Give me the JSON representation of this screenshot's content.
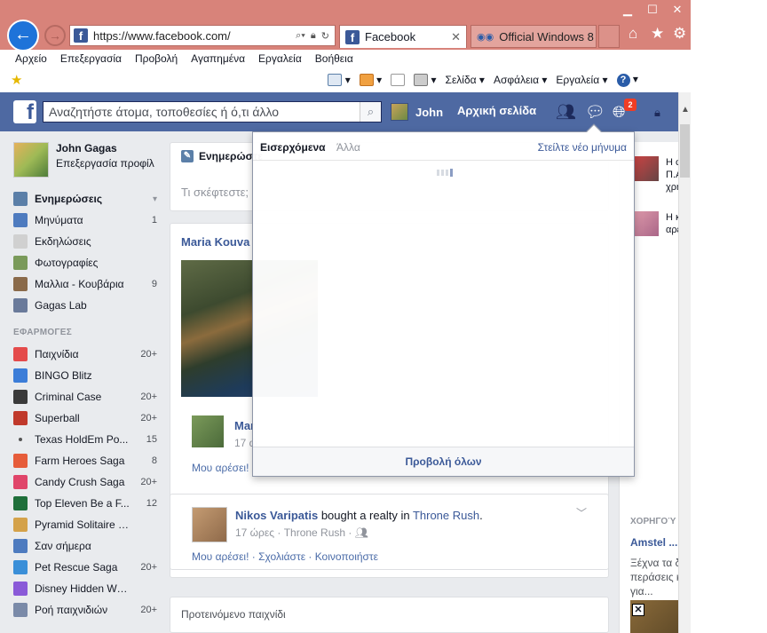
{
  "browser": {
    "url": "https://www.facebook.com/",
    "tabs": [
      {
        "label": "Facebook",
        "active": true
      },
      {
        "label": "Official Windows 8 ...",
        "active": false
      }
    ],
    "menu": [
      "Αρχείο",
      "Επεξεργασία",
      "Προβολή",
      "Αγαπημένα",
      "Εργαλεία",
      "Βοήθεια"
    ],
    "commands": [
      "Σελίδα",
      "Ασφάλεια",
      "Εργαλεία"
    ],
    "icons": {
      "back": "arrow-left-icon",
      "forward": "arrow-right-icon",
      "home": "home-icon",
      "favorites": "star-icon",
      "tools": "gear-icon"
    },
    "accent_color": "#d8837a"
  },
  "fb_header": {
    "search_placeholder": "Αναζητήστε άτομα, τοποθεσίες ή ό,τι άλλο",
    "user_name": "John",
    "home_label": "Αρχική σελίδα",
    "notification_count": "2",
    "bar_color": "#4e69a2"
  },
  "sidebar": {
    "profile_name": "John Gagas",
    "profile_edit": "Επεξεργασία προφίλ",
    "favorites": [
      {
        "label": "Ενημερώσεις",
        "count": "",
        "color": "#5b7fa8",
        "active": true
      },
      {
        "label": "Μηνύματα",
        "count": "1",
        "color": "#4e7bbf",
        "active": false
      },
      {
        "label": "Εκδηλώσεις",
        "count": "",
        "color": "#d0d0d0",
        "active": false
      },
      {
        "label": "Φωτογραφίες",
        "count": "",
        "color": "#7a9a5a",
        "active": false
      },
      {
        "label": "Μαλλια - Κουβάρια",
        "count": "9",
        "color": "#8a6a4a",
        "active": false
      },
      {
        "label": "Gagas Lab",
        "count": "",
        "color": "#6a7a9a",
        "active": false
      }
    ],
    "apps_header": "ΕΦΑΡΜΟΓΕΣ",
    "apps": [
      {
        "label": "Παιχνίδια",
        "count": "20+",
        "color": "#e44b4b"
      },
      {
        "label": "BINGO Blitz",
        "count": "",
        "color": "#3c7dd8"
      },
      {
        "label": "Criminal Case",
        "count": "20+",
        "color": "#3a3a3a"
      },
      {
        "label": "Superball",
        "count": "20+",
        "color": "#c0392b"
      },
      {
        "label": "Texas HoldEm Po...",
        "count": "15",
        "color": "#ffffff"
      },
      {
        "label": "Farm Heroes Saga",
        "count": "8",
        "color": "#e65c3a"
      },
      {
        "label": "Candy Crush Saga",
        "count": "20+",
        "color": "#e0456a"
      },
      {
        "label": "Top Eleven Be a F...",
        "count": "12",
        "color": "#1f6f3a"
      },
      {
        "label": "Pyramid Solitaire Saga",
        "count": "",
        "color": "#d4a24a"
      },
      {
        "label": "Σαν σήμερα",
        "count": "",
        "color": "#4e7bbf"
      },
      {
        "label": "Pet Rescue Saga",
        "count": "20+",
        "color": "#3a8fd8"
      },
      {
        "label": "Disney Hidden Worlds",
        "count": "",
        "color": "#8a5ad8"
      },
      {
        "label": "Ροή παιχνιδιών",
        "count": "20+",
        "color": "#7a8aa8"
      }
    ]
  },
  "composer": {
    "tab_label": "Ενημερώστε",
    "placeholder": "Τι σκέφτεστε;"
  },
  "feed": {
    "story_author": "Maria Kouva",
    "comment_author": "Mar",
    "comment_time": "17 ώ",
    "comment_like": "Μου αρέσει!",
    "post": {
      "author": "Nikos Varipatis",
      "verb": " bought a realty in ",
      "game": "Throne Rush",
      "period": ".",
      "time": "17 ώρες",
      "app": "Throne Rush",
      "actions": "Μου αρέσει! · Σχολιάστε · Κοινοποιήστε"
    },
    "suggested_title": "Προτεινόμενο παιχνίδι"
  },
  "right_col": {
    "items": [
      {
        "lines": [
          "Η φ",
          "Π.Α",
          "χρή"
        ]
      },
      {
        "lines": [
          "Η κ",
          "αρέ"
        ]
      }
    ],
    "sponsored": "ΧΟΡΗΓΟΎ",
    "ad_title": "Amstel ...",
    "ad_lines": [
      "Ξέχνα τα δ",
      "περάσεις κ",
      "για..."
    ]
  },
  "messages_flyout": {
    "tab_inbox": "Εισερχόμενα",
    "tab_other": "Άλλα",
    "send_new": "Στείλτε νέο μήνυμα",
    "footer": "Προβολή όλων"
  }
}
